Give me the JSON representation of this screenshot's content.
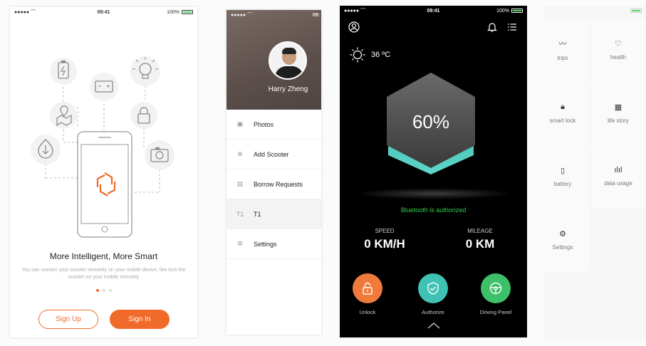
{
  "screen1": {
    "status": {
      "signal": "●●●●● ⌒",
      "time": "09:41",
      "battery": "100%"
    },
    "tagline": "More Intelligent, More Smart",
    "subline": "You can monitor your scooter remotely on your mobile device, like lock the scooter on your mobile remotely",
    "buttons": {
      "sign_up": "Sign Up",
      "sign_in": "Sign In"
    },
    "accent": "#f06a2a"
  },
  "screen2": {
    "status": {
      "signal": "●●●●● ⌒",
      "time": "09:"
    },
    "user_name": "Harry Zheng",
    "menu": [
      {
        "icon": "photo-icon",
        "glyph": "▣",
        "label": "Photos"
      },
      {
        "icon": "add-icon",
        "glyph": "⊕",
        "label": "Add Scooter"
      },
      {
        "icon": "document-icon",
        "glyph": "▤",
        "label": "Borrow Requests"
      },
      {
        "icon": "t1-icon",
        "glyph": "T1",
        "label": "T1"
      },
      {
        "icon": "gear-icon",
        "glyph": "⚙",
        "label": "Settings"
      }
    ]
  },
  "screen3": {
    "status": {
      "signal": "●●●●● ⌒",
      "time": "09:41",
      "battery": "100%"
    },
    "temperature": "36 ºC",
    "battery_percent": "60%",
    "bluetooth": "Bluetooth is authorized",
    "speed": {
      "label": "SPEED",
      "value": "0 KM/H"
    },
    "mileage": {
      "label": "MILEAGE",
      "value": "0 KM"
    },
    "actions": [
      {
        "label": "Unlock",
        "color": "#f07a3a"
      },
      {
        "label": "Authorize",
        "color": "#3fc2b4"
      },
      {
        "label": "Driving Panel",
        "color": "#3cc06a"
      }
    ]
  },
  "screen4": {
    "tiles": [
      {
        "icon": "trips-icon",
        "glyph": "〰",
        "label": "trips"
      },
      {
        "icon": "health-icon",
        "glyph": "♡",
        "label": "health"
      },
      {
        "icon": "lock-icon",
        "glyph": "🔒︎",
        "label": "smart lock"
      },
      {
        "icon": "calendar-icon",
        "glyph": "▦",
        "label": "life story"
      },
      {
        "icon": "battery-icon",
        "glyph": "▯",
        "label": "battery"
      },
      {
        "icon": "bar-chart-icon",
        "glyph": "ılıl",
        "label": "data usage"
      },
      {
        "icon": "gear-icon",
        "glyph": "⚙",
        "label": "Settings"
      }
    ]
  }
}
